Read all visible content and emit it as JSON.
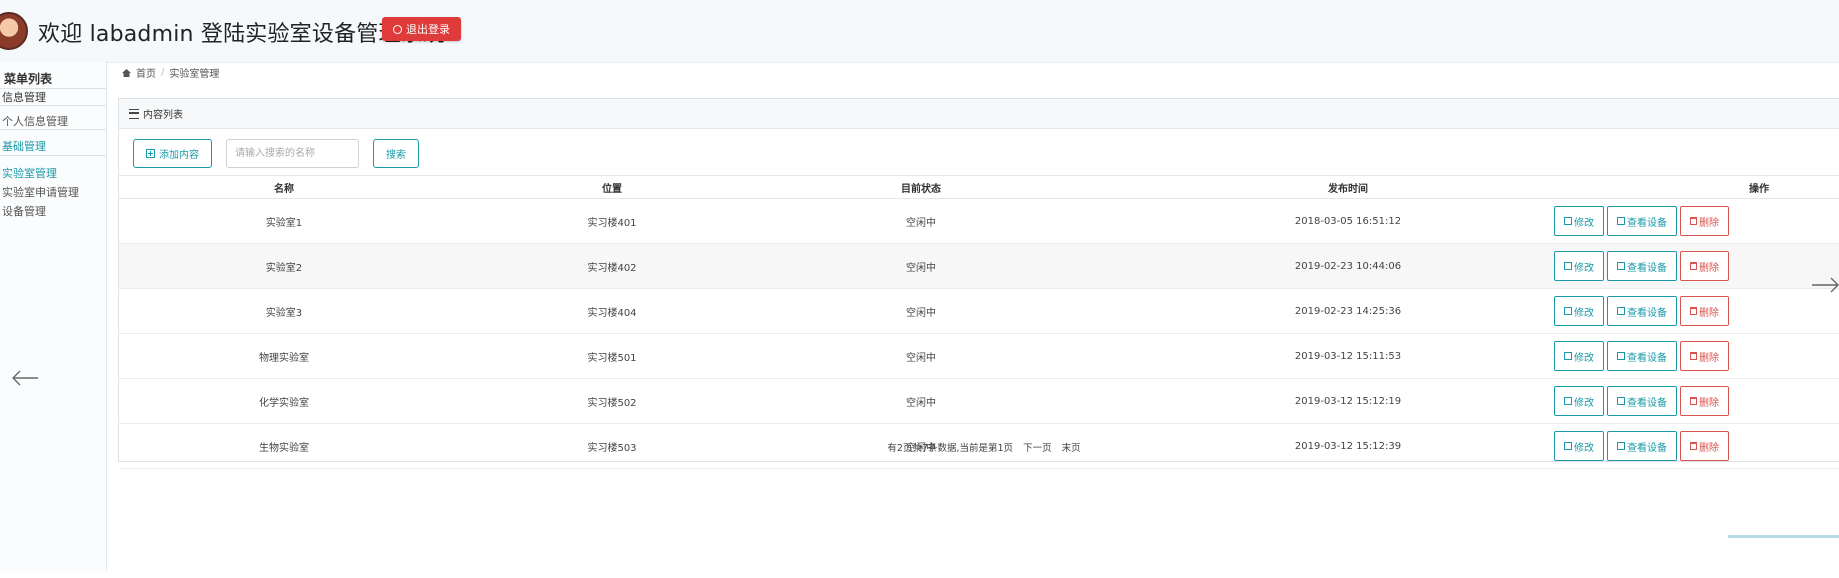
{
  "header": {
    "title": "欢迎 labadmin 登陆实验室设备管理系统",
    "logout_label": "退出登录",
    "accent": "#e03b3b"
  },
  "sidebar": {
    "menu_title": "菜单列表",
    "groups": [
      {
        "label": "信息管理",
        "items": [
          {
            "label": "个人信息管理"
          }
        ]
      },
      {
        "label": "基础管理",
        "items": [
          {
            "label": "实验室管理"
          },
          {
            "label": "实验室申请管理"
          },
          {
            "label": "设备管理"
          }
        ]
      }
    ]
  },
  "breadcrumb": {
    "home": "首页",
    "current": "实验室管理"
  },
  "panel": {
    "title": "内容列表",
    "add_label": "添加内容",
    "search_placeholder": "请输入搜索的名称",
    "search_label": "搜索",
    "columns": [
      "名称",
      "位置",
      "目前状态",
      "发布时间",
      "操作"
    ],
    "rows": [
      {
        "name": "实验室1",
        "location": "实习楼401",
        "status": "空闲中",
        "time": "2018-03-05 16:51:12"
      },
      {
        "name": "实验室2",
        "location": "实习楼402",
        "status": "空闲中",
        "time": "2019-02-23 10:44:06"
      },
      {
        "name": "实验室3",
        "location": "实习楼404",
        "status": "空闲中",
        "time": "2019-02-23 14:25:36"
      },
      {
        "name": "物理实验室",
        "location": "实习楼501",
        "status": "空闲中",
        "time": "2019-03-12 15:11:53"
      },
      {
        "name": "化学实验室",
        "location": "实习楼502",
        "status": "空闲中",
        "time": "2019-03-12 15:12:19"
      },
      {
        "name": "生物实验室",
        "location": "实习楼503",
        "status": "空闲中",
        "time": "2019-03-12 15:12:39"
      }
    ],
    "op_edit": "修改",
    "op_view": "查看设备",
    "op_delete": "删除",
    "pager": {
      "info": "有2页共7条数据,当前是第1页",
      "next": "下一页",
      "last": "末页"
    }
  },
  "colors": {
    "primary": "#1a9aa8",
    "danger": "#d9534f"
  }
}
